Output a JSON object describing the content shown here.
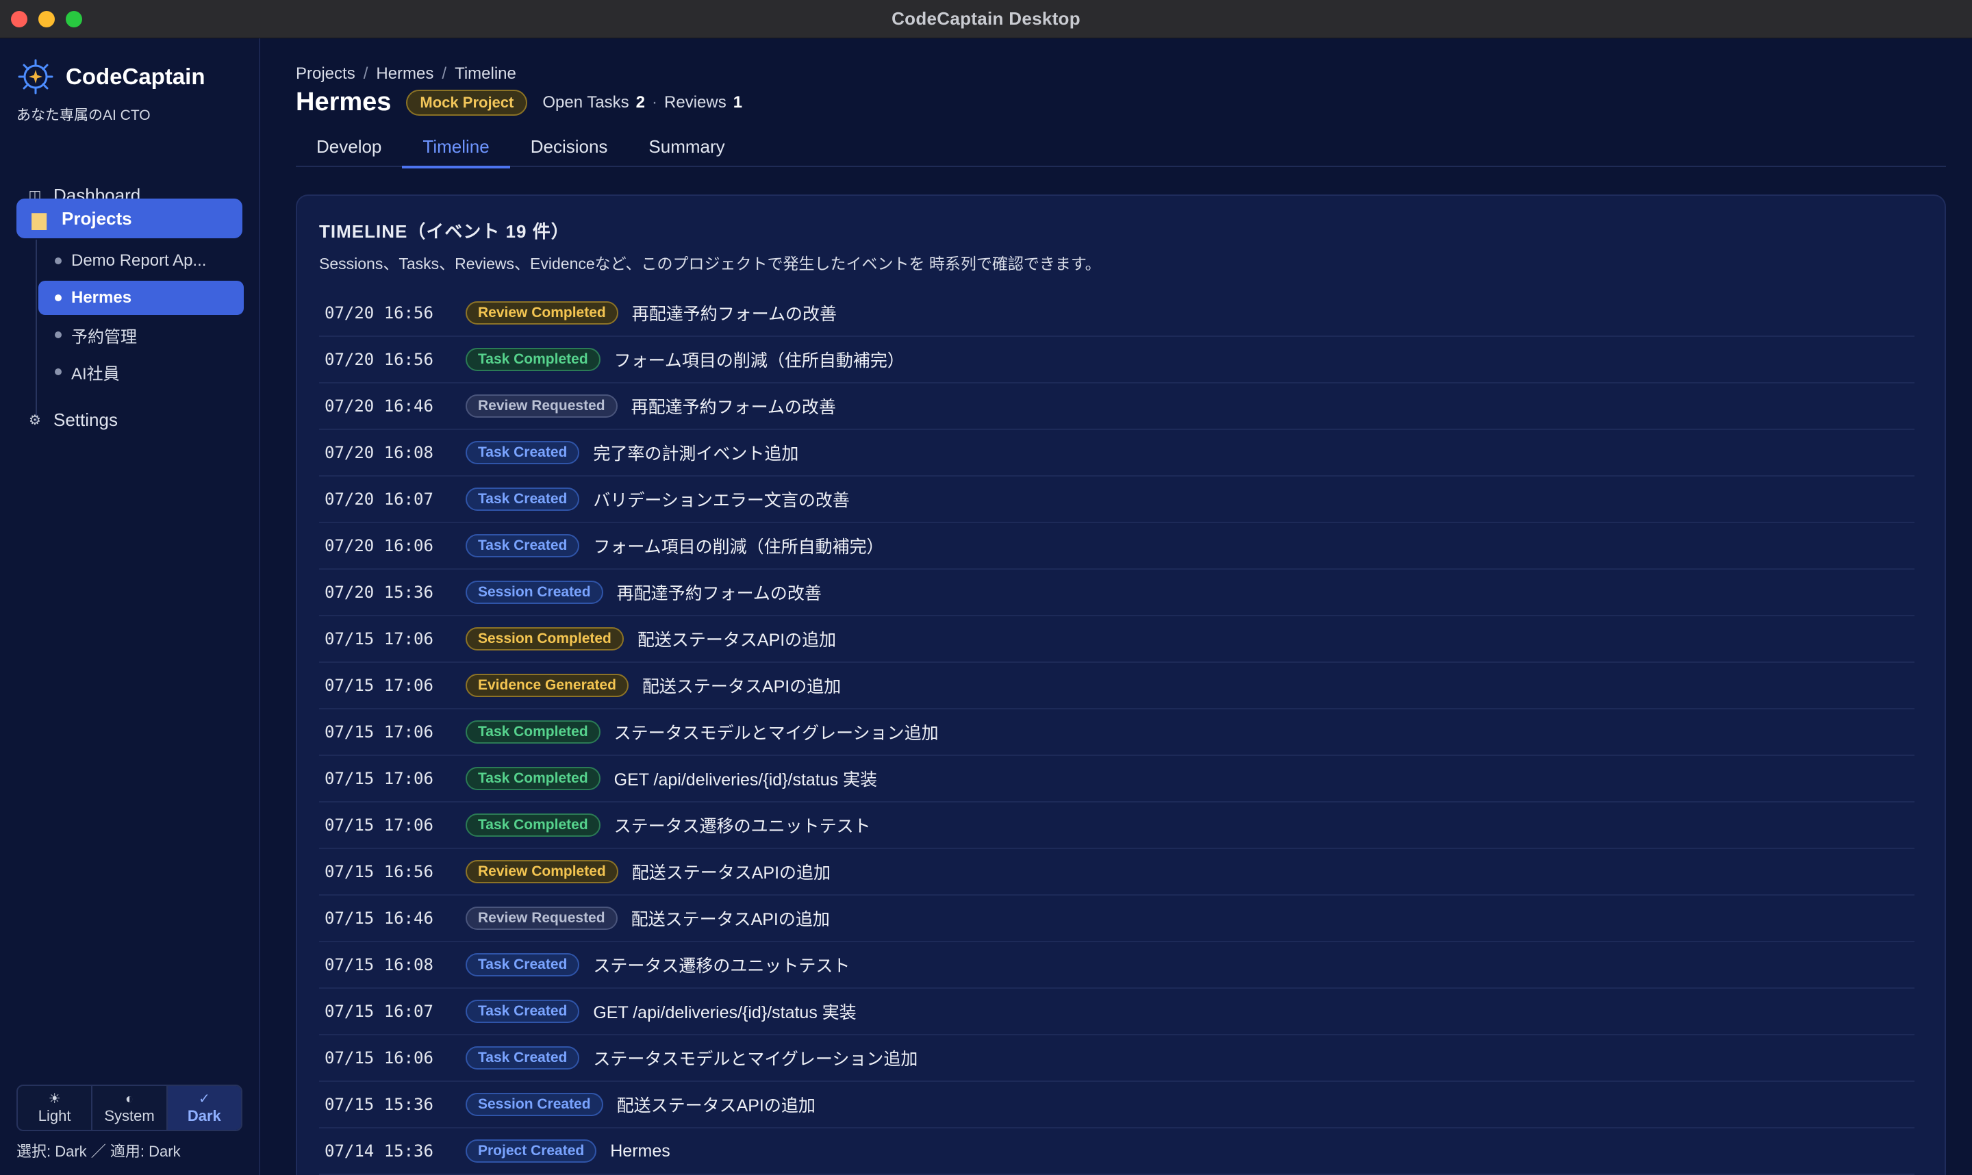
{
  "window": {
    "title": "CodeCaptain Desktop"
  },
  "sidebar": {
    "brand_name": "CodeCaptain",
    "brand_sub": "あなた専属のAI CTO",
    "nav": [
      {
        "label": "Dashboard",
        "icon": "dashboard-icon"
      },
      {
        "label": "Projects",
        "icon": "folder-icon"
      },
      {
        "label": "Settings",
        "icon": "gear-icon"
      }
    ],
    "projects": [
      {
        "label": "Demo Report Ap..."
      },
      {
        "label": "Hermes"
      },
      {
        "label": "予約管理"
      },
      {
        "label": "AI社員"
      }
    ],
    "theme": {
      "options": [
        {
          "label": "Light",
          "glyph": "☀"
        },
        {
          "label": "System",
          "glyph": "◐"
        },
        {
          "label": "Dark",
          "glyph": "✓"
        }
      ],
      "selected": "Dark",
      "note": "選択: Dark ／ 適用: Dark"
    }
  },
  "header": {
    "breadcrumb": [
      "Projects",
      "Hermes",
      "Timeline"
    ],
    "title": "Hermes",
    "badge": "Mock Project",
    "open_tasks_label": "Open Tasks",
    "open_tasks_count": "2",
    "reviews_label": "Reviews",
    "reviews_count": "1"
  },
  "tabs": [
    {
      "label": "Develop"
    },
    {
      "label": "Timeline"
    },
    {
      "label": "Decisions"
    },
    {
      "label": "Summary"
    }
  ],
  "timeline": {
    "title": "TIMELINE（イベント 19 件）",
    "description": "Sessions、Tasks、Reviews、Evidenceなど、このプロジェクトで発生したイベントを 時系列で確認できます。",
    "events": [
      {
        "time": "07/20 16:56",
        "type": "Review Completed",
        "text": "再配達予約フォームの改善"
      },
      {
        "time": "07/20 16:56",
        "type": "Task Completed",
        "text": "フォーム項目の削減（住所自動補完）"
      },
      {
        "time": "07/20 16:46",
        "type": "Review Requested",
        "text": "再配達予約フォームの改善"
      },
      {
        "time": "07/20 16:08",
        "type": "Task Created",
        "text": "完了率の計測イベント追加"
      },
      {
        "time": "07/20 16:07",
        "type": "Task Created",
        "text": "バリデーションエラー文言の改善"
      },
      {
        "time": "07/20 16:06",
        "type": "Task Created",
        "text": "フォーム項目の削減（住所自動補完）"
      },
      {
        "time": "07/20 15:36",
        "type": "Session Created",
        "text": "再配達予約フォームの改善"
      },
      {
        "time": "07/15 17:06",
        "type": "Session Completed",
        "text": "配送ステータスAPIの追加"
      },
      {
        "time": "07/15 17:06",
        "type": "Evidence Generated",
        "text": "配送ステータスAPIの追加"
      },
      {
        "time": "07/15 17:06",
        "type": "Task Completed",
        "text": "ステータスモデルとマイグレーション追加"
      },
      {
        "time": "07/15 17:06",
        "type": "Task Completed",
        "text": "GET /api/deliveries/{id}/status 実装"
      },
      {
        "time": "07/15 17:06",
        "type": "Task Completed",
        "text": "ステータス遷移のユニットテスト"
      },
      {
        "time": "07/15 16:56",
        "type": "Review Completed",
        "text": "配送ステータスAPIの追加"
      },
      {
        "time": "07/15 16:46",
        "type": "Review Requested",
        "text": "配送ステータスAPIの追加"
      },
      {
        "time": "07/15 16:08",
        "type": "Task Created",
        "text": "ステータス遷移のユニットテスト"
      },
      {
        "time": "07/15 16:07",
        "type": "Task Created",
        "text": "GET /api/deliveries/{id}/status 実装"
      },
      {
        "time": "07/15 16:06",
        "type": "Task Created",
        "text": "ステータスモデルとマイグレーション追加"
      },
      {
        "time": "07/15 15:36",
        "type": "Session Created",
        "text": "配送ステータスAPIの追加"
      },
      {
        "time": "07/14 15:36",
        "type": "Project Created",
        "text": "Hermes"
      }
    ]
  },
  "colors": {
    "accent": "#3e63dd",
    "background": "#0b1434",
    "panel": "#111d48",
    "badge_yellow": "#f4c551",
    "badge_green": "#56d38d",
    "badge_blue": "#7aa4ff",
    "badge_gray": "#b9c0d4"
  }
}
